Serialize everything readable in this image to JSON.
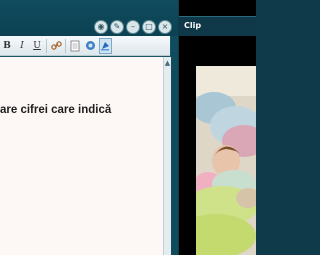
{
  "editor": {
    "window_buttons": [
      {
        "name": "camera-icon",
        "glyph": "◉"
      },
      {
        "name": "wrench-icon",
        "glyph": "✎"
      },
      {
        "name": "minimize-icon",
        "glyph": "–"
      },
      {
        "name": "maximize-icon",
        "glyph": "□"
      },
      {
        "name": "close-icon",
        "glyph": "×"
      }
    ],
    "toolbar": {
      "bold_label": "B",
      "italic_label": "I",
      "underline_label": "U"
    },
    "document_text": "are cifrei care indică"
  },
  "clip": {
    "title": "Clip"
  },
  "colors": {
    "window_frame": "#1a5568",
    "titlebar": "#0f4c5e",
    "document_bg": "#fdf8f5",
    "clip_bg": "#000000"
  }
}
